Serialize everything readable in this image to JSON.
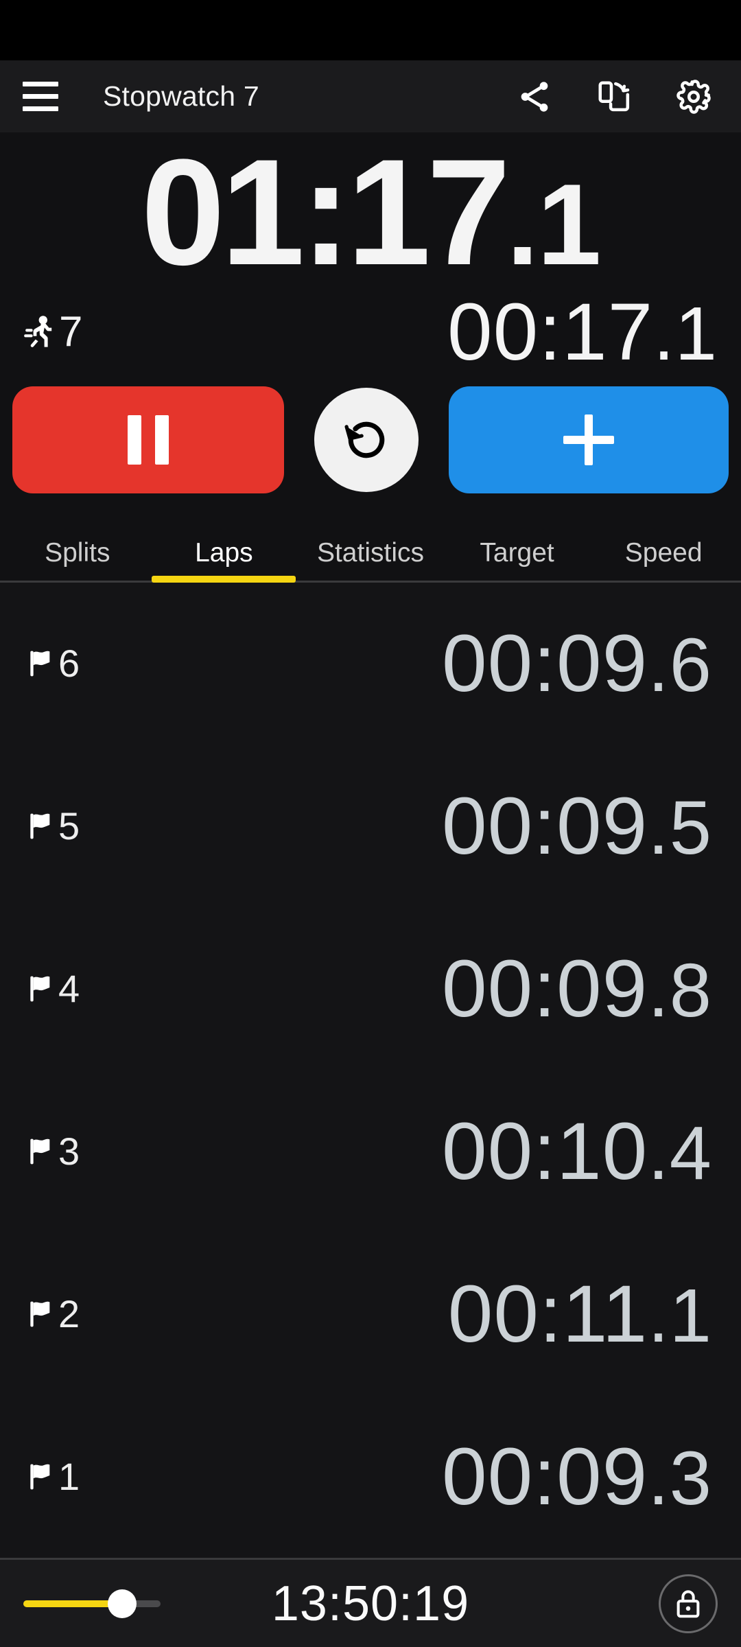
{
  "statusbar": {
    "content": ""
  },
  "appbar": {
    "menu_icon": "hamburger-menu-icon",
    "title": "Stopwatch 7",
    "actions": [
      {
        "name": "share-icon",
        "label": "Share"
      },
      {
        "name": "screen-rotation-icon",
        "label": "Rotate screen"
      },
      {
        "name": "gear-icon",
        "label": "Settings"
      }
    ]
  },
  "timer": {
    "main_time": "01:17",
    "main_fraction": ".1",
    "lap_icon": "running-person-icon",
    "lap_count": "7",
    "current_lap_time": "00:17",
    "current_lap_fraction": ".1"
  },
  "controls": {
    "pause": {
      "name": "pause-button",
      "label": "Pause",
      "color": "#e5352c"
    },
    "reset": {
      "name": "reset-button",
      "label": "Reset",
      "color": "#f1f1f1"
    },
    "lap": {
      "name": "add-lap-button",
      "label": "Lap",
      "color": "#1f8fe8"
    }
  },
  "tabs": {
    "active_index": 1,
    "accent_color": "#f5d512",
    "items": [
      {
        "label": "Splits"
      },
      {
        "label": "Laps"
      },
      {
        "label": "Statistics"
      },
      {
        "label": "Target"
      },
      {
        "label": "Speed"
      }
    ]
  },
  "laps": {
    "icon": "flag-icon",
    "rows": [
      {
        "number": "6",
        "time": "00:09",
        "fraction": ".6"
      },
      {
        "number": "5",
        "time": "00:09",
        "fraction": ".5"
      },
      {
        "number": "4",
        "time": "00:09",
        "fraction": ".8"
      },
      {
        "number": "3",
        "time": "00:10",
        "fraction": ".4"
      },
      {
        "number": "2",
        "time": "00:11",
        "fraction": ".1"
      },
      {
        "number": "1",
        "time": "00:09",
        "fraction": ".3"
      }
    ]
  },
  "bottombar": {
    "slider": {
      "name": "brightness-slider",
      "value_percent": 72,
      "fill_color": "#f5d512"
    },
    "clock": "13:50:19",
    "lock": {
      "name": "lock-button",
      "icon": "lock-icon"
    }
  }
}
